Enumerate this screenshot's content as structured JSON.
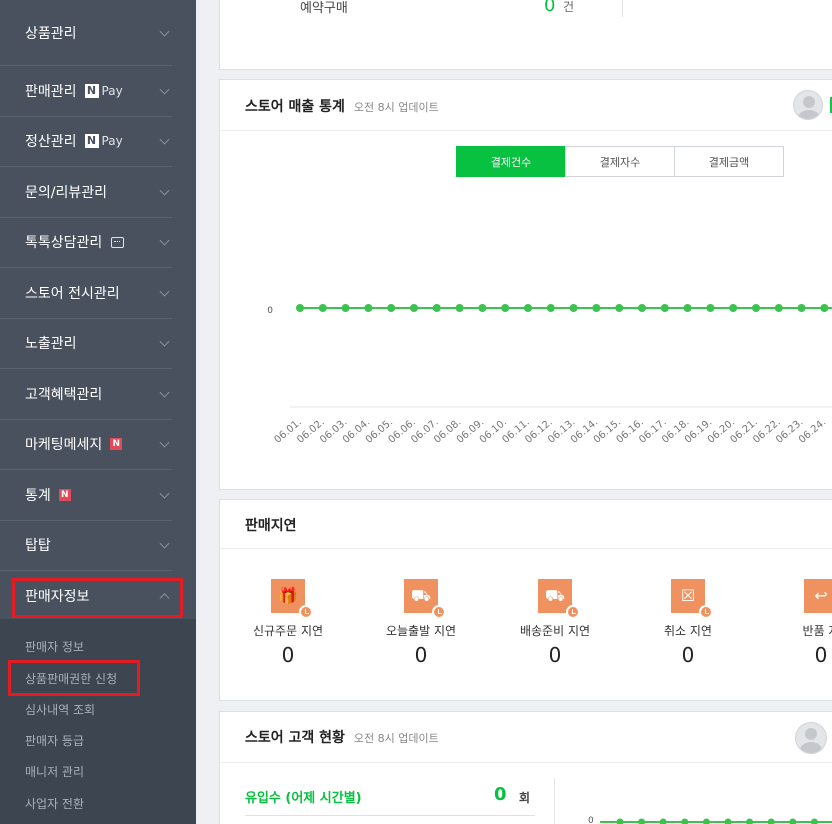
{
  "sidebar": {
    "items": [
      {
        "label": "상품관리"
      },
      {
        "label": "판매관리",
        "badge": "Pay"
      },
      {
        "label": "정산관리",
        "badge": "Pay"
      },
      {
        "label": "문의/리뷰관리"
      },
      {
        "label": "톡톡상담관리"
      },
      {
        "label": "스토어 전시관리"
      },
      {
        "label": "노출관리"
      },
      {
        "label": "고객혜택관리"
      },
      {
        "label": "마케팅메세지",
        "badge": "N"
      },
      {
        "label": "통계",
        "badge": "N"
      },
      {
        "label": "탑탑"
      },
      {
        "label": "판매자정보"
      }
    ],
    "npay_n": "N",
    "submenu": [
      {
        "label": "판매자 정보"
      },
      {
        "label": "상품판매권한 신청"
      },
      {
        "label": "심사내역 조회"
      },
      {
        "label": "판매자 등급"
      },
      {
        "label": "매니저 관리"
      },
      {
        "label": "사업자 전환"
      }
    ]
  },
  "top_card": {
    "label": "예약구매",
    "value": "0",
    "unit": "건"
  },
  "sales_stats": {
    "title": "스토어 매출 통계",
    "update": "오전 8시 업데이트",
    "tabs": [
      "결제건수",
      "결제자수",
      "결제금액"
    ],
    "active_tab": 0
  },
  "chart_data": {
    "type": "line",
    "categories": [
      "06.01.",
      "06.02.",
      "06.03.",
      "06.04.",
      "06.05.",
      "06.06.",
      "06.07.",
      "06.08.",
      "06.09.",
      "06.10.",
      "06.11.",
      "06.12.",
      "06.13.",
      "06.14.",
      "06.15.",
      "06.16.",
      "06.17.",
      "06.18.",
      "06.19.",
      "06.20.",
      "06.21.",
      "06.22.",
      "06.23.",
      "06.24."
    ],
    "values": [
      0,
      0,
      0,
      0,
      0,
      0,
      0,
      0,
      0,
      0,
      0,
      0,
      0,
      0,
      0,
      0,
      0,
      0,
      0,
      0,
      0,
      0,
      0,
      0
    ],
    "y_ticks": [
      "0"
    ],
    "color": "#3cc24f",
    "grid": false
  },
  "sales_delay": {
    "title": "판매지연",
    "items": [
      {
        "label": "신규주문 지연",
        "value": "0",
        "icon": "gift-icon"
      },
      {
        "label": "오늘출발 지연",
        "value": "0",
        "icon": "fast-truck-icon"
      },
      {
        "label": "배송준비 지연",
        "value": "0",
        "icon": "truck-icon"
      },
      {
        "label": "취소 지연",
        "value": "0",
        "icon": "cancel-box-icon"
      },
      {
        "label": "반품 지",
        "value": "0",
        "icon": "return-icon"
      }
    ]
  },
  "customer_stats": {
    "title": "스토어 고객 현황",
    "update": "오전 8시 업데이트",
    "inflow_label": "유입수 (어제 시간별)",
    "inflow_value": "0",
    "inflow_unit": "회",
    "chart_tick": "0"
  },
  "colors": {
    "sidebar": "#48515d",
    "accent_green": "#09c140",
    "highlight_red": "#e31b23",
    "delay_orange": "#f0925f"
  }
}
